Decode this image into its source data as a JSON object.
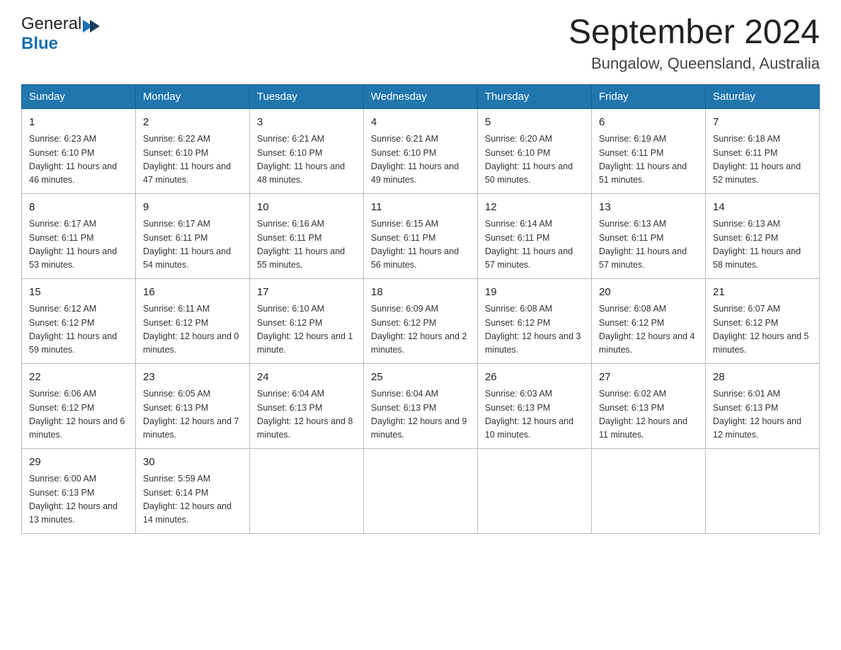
{
  "logo": {
    "general": "General",
    "blue": "Blue"
  },
  "title": "September 2024",
  "location": "Bungalow, Queensland, Australia",
  "headers": [
    "Sunday",
    "Monday",
    "Tuesday",
    "Wednesday",
    "Thursday",
    "Friday",
    "Saturday"
  ],
  "weeks": [
    [
      {
        "day": "1",
        "sunrise": "6:23 AM",
        "sunset": "6:10 PM",
        "daylight": "11 hours and 46 minutes."
      },
      {
        "day": "2",
        "sunrise": "6:22 AM",
        "sunset": "6:10 PM",
        "daylight": "11 hours and 47 minutes."
      },
      {
        "day": "3",
        "sunrise": "6:21 AM",
        "sunset": "6:10 PM",
        "daylight": "11 hours and 48 minutes."
      },
      {
        "day": "4",
        "sunrise": "6:21 AM",
        "sunset": "6:10 PM",
        "daylight": "11 hours and 49 minutes."
      },
      {
        "day": "5",
        "sunrise": "6:20 AM",
        "sunset": "6:10 PM",
        "daylight": "11 hours and 50 minutes."
      },
      {
        "day": "6",
        "sunrise": "6:19 AM",
        "sunset": "6:11 PM",
        "daylight": "11 hours and 51 minutes."
      },
      {
        "day": "7",
        "sunrise": "6:18 AM",
        "sunset": "6:11 PM",
        "daylight": "11 hours and 52 minutes."
      }
    ],
    [
      {
        "day": "8",
        "sunrise": "6:17 AM",
        "sunset": "6:11 PM",
        "daylight": "11 hours and 53 minutes."
      },
      {
        "day": "9",
        "sunrise": "6:17 AM",
        "sunset": "6:11 PM",
        "daylight": "11 hours and 54 minutes."
      },
      {
        "day": "10",
        "sunrise": "6:16 AM",
        "sunset": "6:11 PM",
        "daylight": "11 hours and 55 minutes."
      },
      {
        "day": "11",
        "sunrise": "6:15 AM",
        "sunset": "6:11 PM",
        "daylight": "11 hours and 56 minutes."
      },
      {
        "day": "12",
        "sunrise": "6:14 AM",
        "sunset": "6:11 PM",
        "daylight": "11 hours and 57 minutes."
      },
      {
        "day": "13",
        "sunrise": "6:13 AM",
        "sunset": "6:11 PM",
        "daylight": "11 hours and 57 minutes."
      },
      {
        "day": "14",
        "sunrise": "6:13 AM",
        "sunset": "6:12 PM",
        "daylight": "11 hours and 58 minutes."
      }
    ],
    [
      {
        "day": "15",
        "sunrise": "6:12 AM",
        "sunset": "6:12 PM",
        "daylight": "11 hours and 59 minutes."
      },
      {
        "day": "16",
        "sunrise": "6:11 AM",
        "sunset": "6:12 PM",
        "daylight": "12 hours and 0 minutes."
      },
      {
        "day": "17",
        "sunrise": "6:10 AM",
        "sunset": "6:12 PM",
        "daylight": "12 hours and 1 minute."
      },
      {
        "day": "18",
        "sunrise": "6:09 AM",
        "sunset": "6:12 PM",
        "daylight": "12 hours and 2 minutes."
      },
      {
        "day": "19",
        "sunrise": "6:08 AM",
        "sunset": "6:12 PM",
        "daylight": "12 hours and 3 minutes."
      },
      {
        "day": "20",
        "sunrise": "6:08 AM",
        "sunset": "6:12 PM",
        "daylight": "12 hours and 4 minutes."
      },
      {
        "day": "21",
        "sunrise": "6:07 AM",
        "sunset": "6:12 PM",
        "daylight": "12 hours and 5 minutes."
      }
    ],
    [
      {
        "day": "22",
        "sunrise": "6:06 AM",
        "sunset": "6:12 PM",
        "daylight": "12 hours and 6 minutes."
      },
      {
        "day": "23",
        "sunrise": "6:05 AM",
        "sunset": "6:13 PM",
        "daylight": "12 hours and 7 minutes."
      },
      {
        "day": "24",
        "sunrise": "6:04 AM",
        "sunset": "6:13 PM",
        "daylight": "12 hours and 8 minutes."
      },
      {
        "day": "25",
        "sunrise": "6:04 AM",
        "sunset": "6:13 PM",
        "daylight": "12 hours and 9 minutes."
      },
      {
        "day": "26",
        "sunrise": "6:03 AM",
        "sunset": "6:13 PM",
        "daylight": "12 hours and 10 minutes."
      },
      {
        "day": "27",
        "sunrise": "6:02 AM",
        "sunset": "6:13 PM",
        "daylight": "12 hours and 11 minutes."
      },
      {
        "day": "28",
        "sunrise": "6:01 AM",
        "sunset": "6:13 PM",
        "daylight": "12 hours and 12 minutes."
      }
    ],
    [
      {
        "day": "29",
        "sunrise": "6:00 AM",
        "sunset": "6:13 PM",
        "daylight": "12 hours and 13 minutes."
      },
      {
        "day": "30",
        "sunrise": "5:59 AM",
        "sunset": "6:14 PM",
        "daylight": "12 hours and 14 minutes."
      },
      null,
      null,
      null,
      null,
      null
    ]
  ],
  "labels": {
    "sunrise": "Sunrise: ",
    "sunset": "Sunset: ",
    "daylight": "Daylight: "
  }
}
